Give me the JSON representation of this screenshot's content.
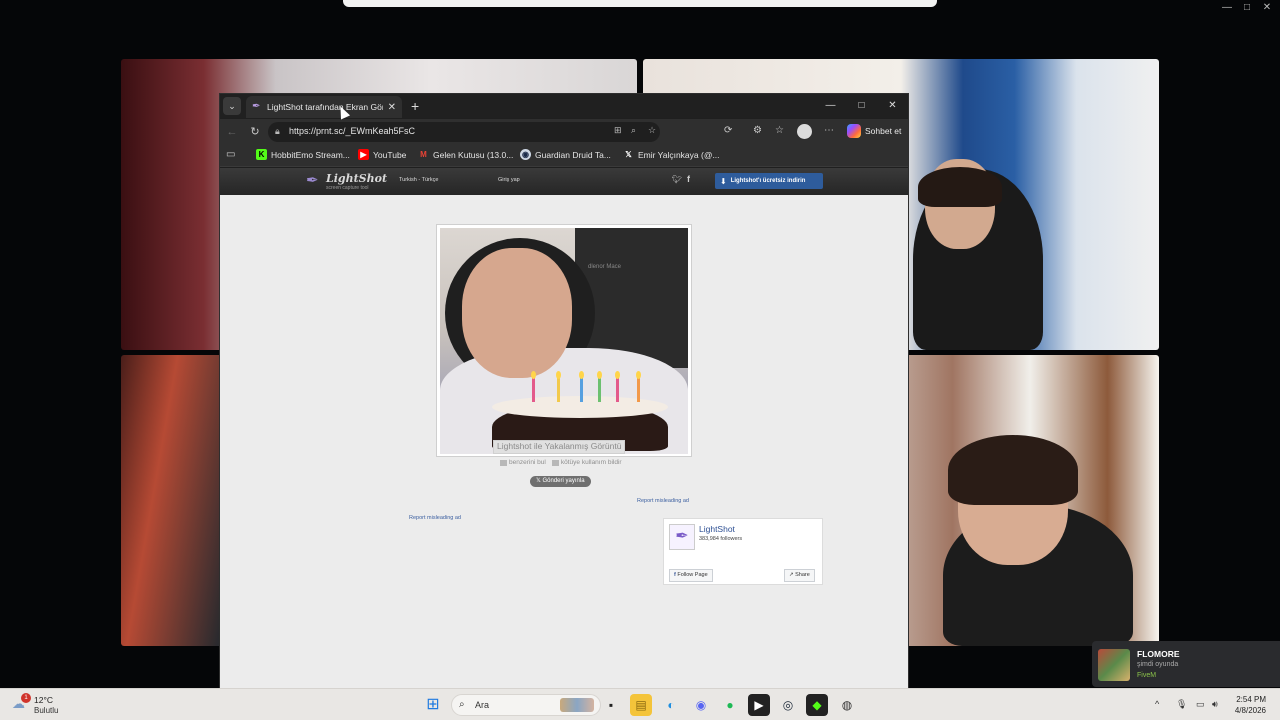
{
  "browser": {
    "tab_title": "LightShot tarafından Ekran Görüntü",
    "url": "https://prnt.sc/_EWmKeah5FsC",
    "copilot_label": "Sohbet et",
    "favorites": [
      "HobbitEmo Stream...",
      "YouTube",
      "Gelen Kutusu (13.0...",
      "Guardian Druid Ta...",
      "Emir Yalçınkaya (@..."
    ]
  },
  "lightshot": {
    "logo_name": "LightShot",
    "logo_tagline": "screen capture tool",
    "language": "Turkish - Türkçe",
    "login": "Giriş yap",
    "download": "Lightshot'ı ücretsiz indirin",
    "screenshot_brand": "dlenor     Mace",
    "caption": "Lightshot ile Yakalanmış Görüntü",
    "find_similar": "benzerini bul",
    "report_abuse": "kötüye kullanım bildir",
    "post_button": "𝕏  Gönderi yayınla",
    "report_ad_1": "Report misleading ad",
    "report_ad_2": "Report misleading ad",
    "fb_page_name": "LightShot",
    "fb_followers": "383,984 followers",
    "fb_follow": "Follow Page",
    "fb_share": "Share"
  },
  "notification": {
    "name": "FLOMORE",
    "status": "şimdi oyunda",
    "game": "FiveM"
  },
  "taskbar": {
    "temperature": "12°C",
    "condition": "Bulutlu",
    "weather_badge": "1",
    "search_placeholder": "Ara",
    "time": "2:54 PM",
    "date": "4/8/2026"
  },
  "colors": {
    "accent_blue": "#2e5c9c",
    "link_blue": "#3b5fa0",
    "game_green": "#8bc34a"
  }
}
